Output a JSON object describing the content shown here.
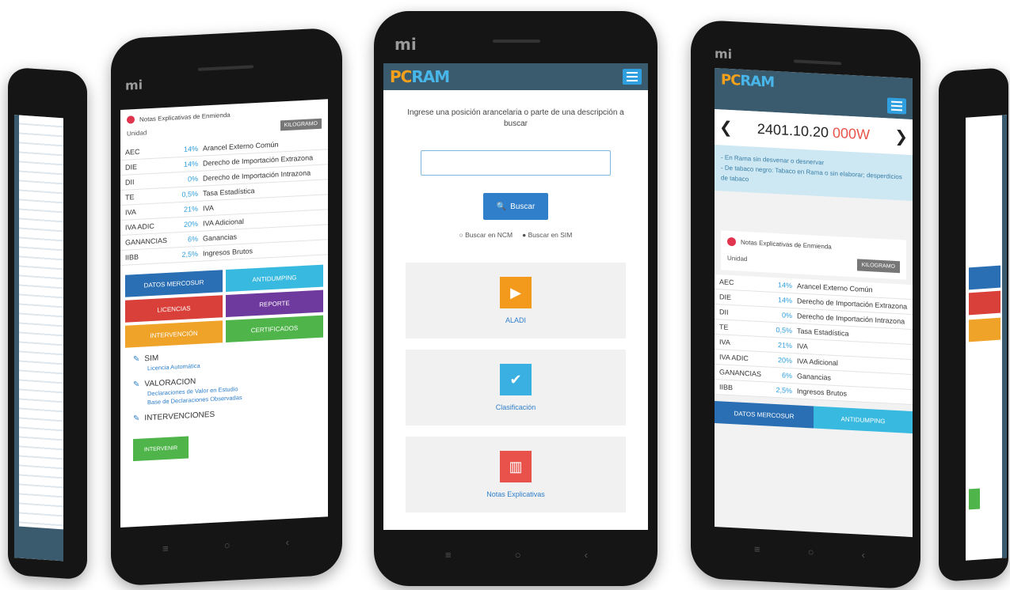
{
  "brand": {
    "part1": "PC",
    "part2": "RAM"
  },
  "device_mark": "mi",
  "nav_keys": [
    "≡",
    "○",
    "‹"
  ],
  "center": {
    "prompt": "Ingrese una posición arancelaria o parte de una descripción a buscar",
    "search_value": "",
    "search_button": "Buscar",
    "radio_ncm": "Buscar en NCM",
    "radio_sim": "Buscar en SIM",
    "cards": [
      {
        "label": "ALADI",
        "color": "#f39a1d",
        "icon": "play-icon"
      },
      {
        "label": "Clasificación",
        "color": "#3ab0e2",
        "icon": "check-icon"
      },
      {
        "label": "Notas Explicativas",
        "color": "#e8524a",
        "icon": "book-icon"
      }
    ]
  },
  "right": {
    "position": "2401.10.20",
    "suffix": "000W",
    "info_lines": [
      "- En Rama sin desvenar o desnervar",
      "- De tabaco negro: Tabaco en Rama o sin elaborar; desperdicios de tabaco"
    ],
    "notes_header": "Notas Explicativas de Enmienda",
    "unit_label": "Unidad",
    "unit_badge": "KILOGRAMO",
    "rows": [
      {
        "k": "AEC",
        "p": "14%",
        "d": "Arancel Externo Común"
      },
      {
        "k": "DIE",
        "p": "14%",
        "d": "Derecho de Importación Extrazona"
      },
      {
        "k": "DII",
        "p": "0%",
        "d": "Derecho de Importación Intrazona"
      },
      {
        "k": "TE",
        "p": "0,5%",
        "d": "Tasa Estadística"
      },
      {
        "k": "IVA",
        "p": "21%",
        "d": "IVA"
      },
      {
        "k": "IVA ADIC",
        "p": "20%",
        "d": "IVA Adicional"
      },
      {
        "k": "GANANCIAS",
        "p": "6%",
        "d": "Ganancias"
      },
      {
        "k": "IIBB",
        "p": "2,5%",
        "d": "Ingresos Brutos"
      }
    ],
    "btn_left": "DATOS MERCOSUR",
    "btn_right": "ANTIDUMPING"
  },
  "left": {
    "notes_header": "Notas Explicativas de Enmienda",
    "unit_label": "Unidad",
    "unit_badge": "KILOGRAMO",
    "rows": [
      {
        "k": "AEC",
        "p": "14%",
        "d": "Arancel Externo Común"
      },
      {
        "k": "DIE",
        "p": "14%",
        "d": "Derecho de Importación Extrazona"
      },
      {
        "k": "DII",
        "p": "0%",
        "d": "Derecho de Importación Intrazona"
      },
      {
        "k": "TE",
        "p": "0,5%",
        "d": "Tasa Estadística"
      },
      {
        "k": "IVA",
        "p": "21%",
        "d": "IVA"
      },
      {
        "k": "IVA ADIC",
        "p": "20%",
        "d": "IVA Adicional"
      },
      {
        "k": "GANANCIAS",
        "p": "6%",
        "d": "Ganancias"
      },
      {
        "k": "IIBB",
        "p": "2,5%",
        "d": "Ingresos Brutos"
      }
    ],
    "buttons": [
      {
        "label": "DATOS MERCOSUR",
        "color": "#2a6fb3"
      },
      {
        "label": "ANTIDUMPING",
        "color": "#38b9df"
      },
      {
        "label": "LICENCIAS",
        "color": "#d9403a"
      },
      {
        "label": "REPORTE",
        "color": "#6f3a9e"
      },
      {
        "label": "INTERVENCIÓN",
        "color": "#f0a329"
      },
      {
        "label": "CERTIFICADOS",
        "color": "#4fb44a"
      }
    ],
    "sections": [
      {
        "title": "SIM",
        "links": [
          "Licencia Automática"
        ]
      },
      {
        "title": "VALORACION",
        "links": [
          "Declaraciones de Valor en Estudio",
          "Base de Declaraciones Observadas"
        ]
      },
      {
        "title": "INTERVENCIONES",
        "links": []
      }
    ],
    "green_button": "INTERVENIR"
  }
}
